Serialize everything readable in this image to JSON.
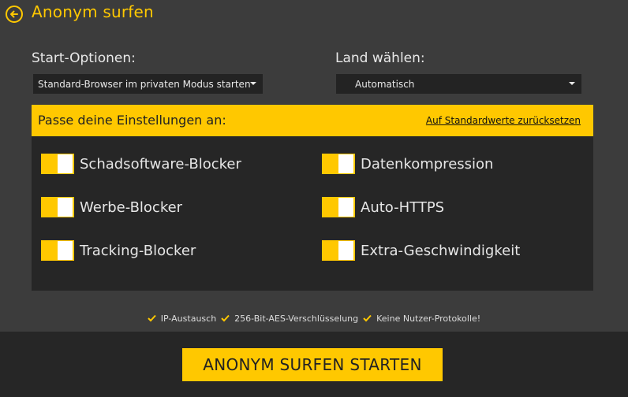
{
  "header": {
    "title": "Anonym surfen",
    "back_icon": "arrow-left-circle-icon"
  },
  "start_options": {
    "label": "Start-Optionen:",
    "selected": "Standard-Browser im privaten Modus starten"
  },
  "country": {
    "label": "Land wählen:",
    "selected": "Automatisch"
  },
  "settings": {
    "title": "Passe deine Einstellungen an:",
    "reset_label": "Auf Standardwerte zurücksetzen",
    "toggles": [
      {
        "label": "Schadsoftware-Blocker",
        "on": true
      },
      {
        "label": "Werbe-Blocker",
        "on": true
      },
      {
        "label": "Tracking-Blocker",
        "on": true
      },
      {
        "label": "Datenkompression",
        "on": true
      },
      {
        "label": "Auto-HTTPS",
        "on": true
      },
      {
        "label": "Extra-Geschwindigkeit",
        "on": true
      }
    ]
  },
  "features": [
    {
      "icon": "checkmark-icon",
      "label": "IP-Austausch"
    },
    {
      "icon": "checkmark-icon",
      "label": "256-Bit-AES-Verschlüsselung"
    },
    {
      "icon": "checkmark-icon",
      "label": "Keine Nutzer-Protokolle!"
    }
  ],
  "footer": {
    "start_button": "ANONYM SURFEN STARTEN"
  },
  "colors": {
    "accent": "#ffc800",
    "background": "#3c3c3c",
    "panel": "#262626"
  }
}
